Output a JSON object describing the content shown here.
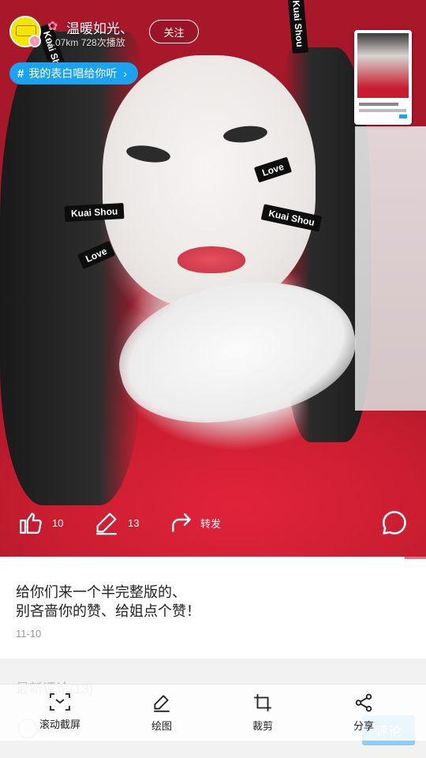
{
  "header": {
    "username": "温暖如光、",
    "distance": "2.07km",
    "plays": "728次播放",
    "follow_label": "关注",
    "topic_label": "我的表白唱给你听"
  },
  "video": {
    "stickers": [
      "Kuai Shou",
      "Love",
      "Kuai Shou",
      "Love",
      "Kuai Shou",
      "Kuai Shou"
    ],
    "progress": 0.95
  },
  "actions": {
    "like_count": "10",
    "comment_count": "13",
    "repost_label": "转发"
  },
  "post": {
    "caption_line1": "给你们来一个半完整版的、",
    "caption_line2": "别吝啬你的赞、给姐点个赞！",
    "date": "11-10"
  },
  "comments": {
    "header": "最新评论(13)",
    "input_placeholder": "评论",
    "send_label": "评论"
  },
  "toolbar": {
    "items": [
      {
        "label": "滚动截屏",
        "icon": "scroll-capture-icon"
      },
      {
        "label": "绘图",
        "icon": "pen-icon"
      },
      {
        "label": "裁剪",
        "icon": "crop-icon"
      },
      {
        "label": "分享",
        "icon": "share-icon"
      }
    ]
  },
  "colors": {
    "accent": "#1aa3f0",
    "send_button": "#8ecbf5"
  }
}
